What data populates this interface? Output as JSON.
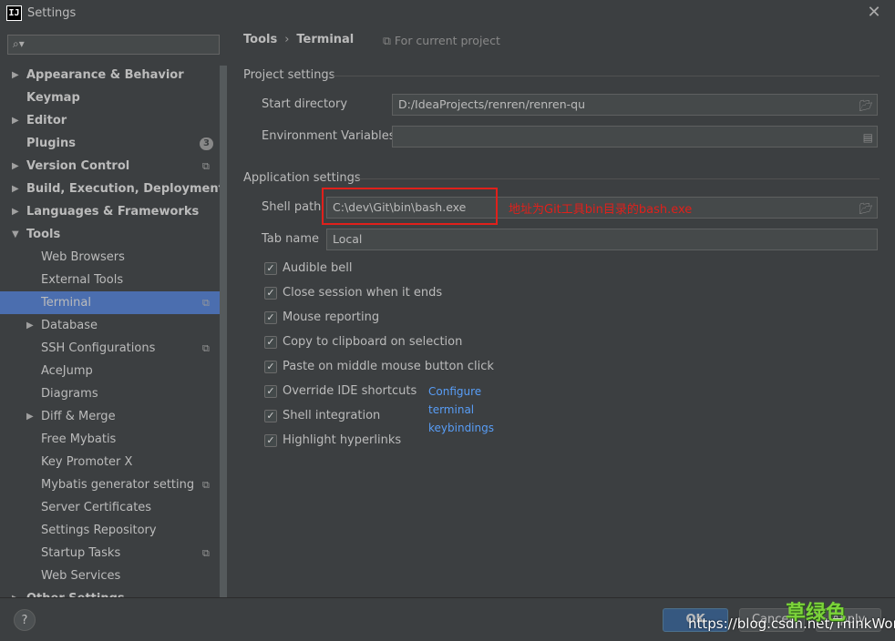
{
  "window": {
    "title": "Settings",
    "app_icon": "IJ"
  },
  "sidebar": {
    "search_placeholder": "",
    "items": [
      {
        "label": "Appearance & Behavior",
        "arrow": "right",
        "level": 0,
        "bold": true
      },
      {
        "label": "Keymap",
        "arrow": "",
        "level": 0,
        "bold": true
      },
      {
        "label": "Editor",
        "arrow": "right",
        "level": 0,
        "bold": true
      },
      {
        "label": "Plugins",
        "arrow": "",
        "level": 0,
        "bold": true,
        "badge": "3"
      },
      {
        "label": "Version Control",
        "arrow": "right",
        "level": 0,
        "bold": true,
        "project_icon": true
      },
      {
        "label": "Build, Execution, Deployment",
        "arrow": "right",
        "level": 0,
        "bold": true
      },
      {
        "label": "Languages & Frameworks",
        "arrow": "right",
        "level": 0,
        "bold": true
      },
      {
        "label": "Tools",
        "arrow": "down",
        "level": 0,
        "bold": true
      },
      {
        "label": "Web Browsers",
        "arrow": "",
        "level": 1
      },
      {
        "label": "External Tools",
        "arrow": "",
        "level": 1
      },
      {
        "label": "Terminal",
        "arrow": "",
        "level": 1,
        "selected": true,
        "project_icon": true
      },
      {
        "label": "Database",
        "arrow": "right",
        "level": 1
      },
      {
        "label": "SSH Configurations",
        "arrow": "",
        "level": 1,
        "project_icon": true
      },
      {
        "label": "AceJump",
        "arrow": "",
        "level": 1
      },
      {
        "label": "Diagrams",
        "arrow": "",
        "level": 1
      },
      {
        "label": "Diff & Merge",
        "arrow": "right",
        "level": 1
      },
      {
        "label": "Free Mybatis",
        "arrow": "",
        "level": 1
      },
      {
        "label": "Key Promoter X",
        "arrow": "",
        "level": 1
      },
      {
        "label": "Mybatis generator setting",
        "arrow": "",
        "level": 1,
        "project_icon": true
      },
      {
        "label": "Server Certificates",
        "arrow": "",
        "level": 1
      },
      {
        "label": "Settings Repository",
        "arrow": "",
        "level": 1
      },
      {
        "label": "Startup Tasks",
        "arrow": "",
        "level": 1,
        "project_icon": true
      },
      {
        "label": "Web Services",
        "arrow": "",
        "level": 1
      },
      {
        "label": "Other Settings",
        "arrow": "right",
        "level": 0,
        "bold": true
      }
    ]
  },
  "breadcrumb": {
    "parent": "Tools",
    "separator": "›",
    "current": "Terminal"
  },
  "for_current_project": "For current project",
  "project_settings": {
    "title": "Project settings",
    "start_directory_label": "Start directory",
    "start_directory_value": "D:/IdeaProjects/renren/renren-qu",
    "env_vars_label": "Environment Variables",
    "env_vars_value": ""
  },
  "application_settings": {
    "title": "Application settings",
    "shell_path_label": "Shell path",
    "shell_path_value": "C:\\dev\\Git\\bin\\bash.exe",
    "tab_name_label": "Tab name",
    "tab_name_value": "Local",
    "checkboxes": [
      {
        "label": "Audible bell",
        "checked": true
      },
      {
        "label": "Close session when it ends",
        "checked": true
      },
      {
        "label": "Mouse reporting",
        "checked": true
      },
      {
        "label": "Copy to clipboard on selection",
        "checked": true
      },
      {
        "label": "Paste on middle mouse button click",
        "checked": true
      },
      {
        "label": "Override IDE shortcuts",
        "checked": true
      },
      {
        "label": "Shell integration",
        "checked": true
      },
      {
        "label": "Highlight hyperlinks",
        "checked": true
      }
    ],
    "keybindings_link": "Configure terminal keybindings"
  },
  "annotation": {
    "note": "地址为Git工具bin目录的bash.exe",
    "color": "#e0201b"
  },
  "footer": {
    "help": "?",
    "ok": "OK",
    "cancel": "Cancel",
    "apply": "Apply"
  },
  "watermark": {
    "url": "https://blog.csdn.net/ThinkWon",
    "logo": "草绿色"
  },
  "colors": {
    "background": "#3c3f41",
    "selection": "#4b6eaf",
    "link": "#589df6",
    "ok_button": "#365880"
  }
}
